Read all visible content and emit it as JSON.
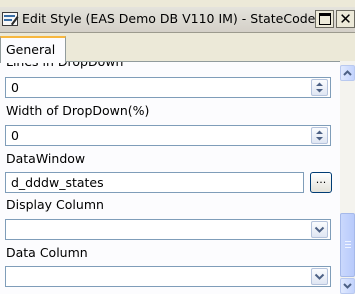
{
  "window": {
    "title": "Edit Style (EAS Demo DB V110 IM) - StateCode",
    "close_glyph": "✕"
  },
  "tabs": [
    {
      "label": "General"
    }
  ],
  "form": {
    "lines_label_partial": "Lines in DropDown",
    "lines_value": "0",
    "width_label": "Width of DropDown(%)",
    "width_value": "0",
    "datawindow_label": "DataWindow",
    "datawindow_value": "d_dddw_states",
    "ellipsis_label": "...",
    "display_column_label": "Display Column",
    "display_column_value": "",
    "data_column_label": "Data Column",
    "data_column_value": ""
  },
  "icons": {
    "app": "edit-style-icon",
    "spin": "spin-arrows-icon",
    "dropdown": "chevron-down-icon",
    "scroll_up": "arrow-up-icon",
    "scroll_down": "arrow-down-icon"
  }
}
